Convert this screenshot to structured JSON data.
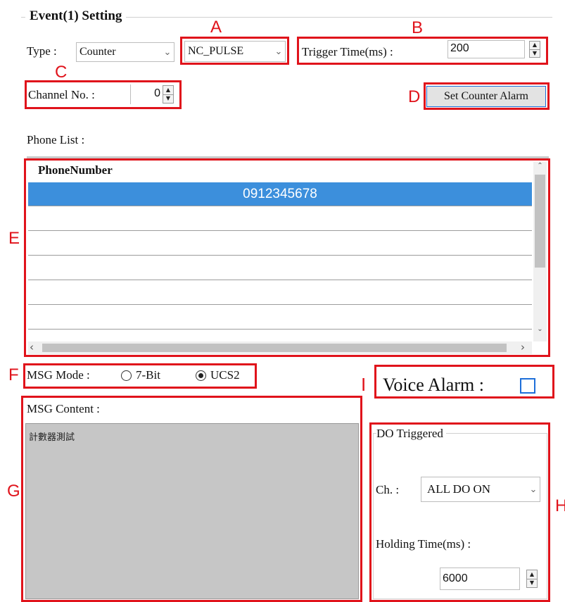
{
  "group_title": "Event(1) Setting",
  "type_label": "Type :",
  "type_value": "Counter",
  "pulse_value": "NC_PULSE",
  "trigger_label": "Trigger Time(ms) :",
  "trigger_value": "200",
  "channel_label": "Channel No. :",
  "channel_value": "0",
  "set_alarm_button": "Set Counter Alarm",
  "phone_list_label": "Phone List :",
  "phone_header": "PhoneNumber",
  "phone_rows": [
    "0912345678"
  ],
  "msg_mode_label": "MSG Mode :",
  "msg_mode_options": [
    "7-Bit",
    "UCS2"
  ],
  "msg_mode_selected": "UCS2",
  "msg_content_label": "MSG Content :",
  "msg_content_value": "計數器測試",
  "voice_alarm_label": "Voice Alarm :",
  "voice_alarm_checked": false,
  "do_group_title": "DO Triggered",
  "do_ch_label": "Ch. :",
  "do_ch_value": "ALL DO ON",
  "holding_label": "Holding Time(ms) :",
  "holding_value": "6000",
  "callouts": {
    "A": "A",
    "B": "B",
    "C": "C",
    "D": "D",
    "E": "E",
    "F": "F",
    "G": "G",
    "H": "H",
    "I": "I"
  },
  "colors": {
    "annotation_red": "#e0131b",
    "selection_blue": "#3c8fdc",
    "textarea_gray": "#c6c6c6",
    "focus_blue": "#1e6fd9"
  }
}
